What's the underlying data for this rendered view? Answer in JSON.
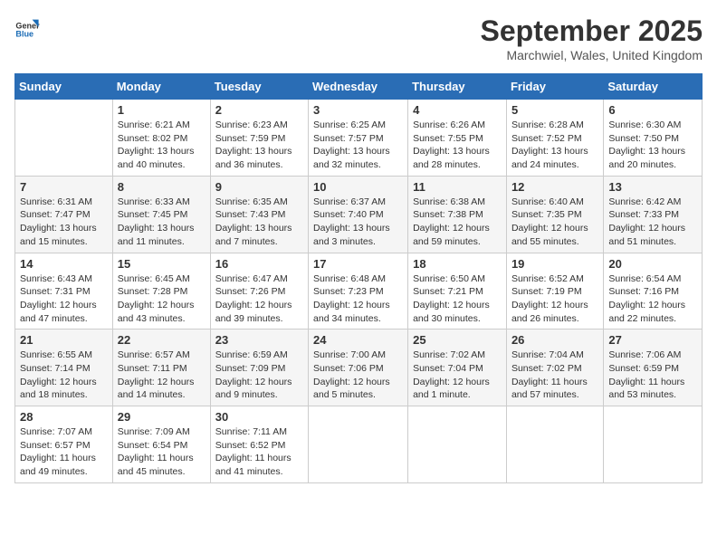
{
  "logo": {
    "general": "General",
    "blue": "Blue"
  },
  "title": "September 2025",
  "subtitle": "Marchwiel, Wales, United Kingdom",
  "days_header": [
    "Sunday",
    "Monday",
    "Tuesday",
    "Wednesday",
    "Thursday",
    "Friday",
    "Saturday"
  ],
  "weeks": [
    [
      {
        "day": "",
        "info": ""
      },
      {
        "day": "1",
        "info": "Sunrise: 6:21 AM\nSunset: 8:02 PM\nDaylight: 13 hours\nand 40 minutes."
      },
      {
        "day": "2",
        "info": "Sunrise: 6:23 AM\nSunset: 7:59 PM\nDaylight: 13 hours\nand 36 minutes."
      },
      {
        "day": "3",
        "info": "Sunrise: 6:25 AM\nSunset: 7:57 PM\nDaylight: 13 hours\nand 32 minutes."
      },
      {
        "day": "4",
        "info": "Sunrise: 6:26 AM\nSunset: 7:55 PM\nDaylight: 13 hours\nand 28 minutes."
      },
      {
        "day": "5",
        "info": "Sunrise: 6:28 AM\nSunset: 7:52 PM\nDaylight: 13 hours\nand 24 minutes."
      },
      {
        "day": "6",
        "info": "Sunrise: 6:30 AM\nSunset: 7:50 PM\nDaylight: 13 hours\nand 20 minutes."
      }
    ],
    [
      {
        "day": "7",
        "info": "Sunrise: 6:31 AM\nSunset: 7:47 PM\nDaylight: 13 hours\nand 15 minutes."
      },
      {
        "day": "8",
        "info": "Sunrise: 6:33 AM\nSunset: 7:45 PM\nDaylight: 13 hours\nand 11 minutes."
      },
      {
        "day": "9",
        "info": "Sunrise: 6:35 AM\nSunset: 7:43 PM\nDaylight: 13 hours\nand 7 minutes."
      },
      {
        "day": "10",
        "info": "Sunrise: 6:37 AM\nSunset: 7:40 PM\nDaylight: 13 hours\nand 3 minutes."
      },
      {
        "day": "11",
        "info": "Sunrise: 6:38 AM\nSunset: 7:38 PM\nDaylight: 12 hours\nand 59 minutes."
      },
      {
        "day": "12",
        "info": "Sunrise: 6:40 AM\nSunset: 7:35 PM\nDaylight: 12 hours\nand 55 minutes."
      },
      {
        "day": "13",
        "info": "Sunrise: 6:42 AM\nSunset: 7:33 PM\nDaylight: 12 hours\nand 51 minutes."
      }
    ],
    [
      {
        "day": "14",
        "info": "Sunrise: 6:43 AM\nSunset: 7:31 PM\nDaylight: 12 hours\nand 47 minutes."
      },
      {
        "day": "15",
        "info": "Sunrise: 6:45 AM\nSunset: 7:28 PM\nDaylight: 12 hours\nand 43 minutes."
      },
      {
        "day": "16",
        "info": "Sunrise: 6:47 AM\nSunset: 7:26 PM\nDaylight: 12 hours\nand 39 minutes."
      },
      {
        "day": "17",
        "info": "Sunrise: 6:48 AM\nSunset: 7:23 PM\nDaylight: 12 hours\nand 34 minutes."
      },
      {
        "day": "18",
        "info": "Sunrise: 6:50 AM\nSunset: 7:21 PM\nDaylight: 12 hours\nand 30 minutes."
      },
      {
        "day": "19",
        "info": "Sunrise: 6:52 AM\nSunset: 7:19 PM\nDaylight: 12 hours\nand 26 minutes."
      },
      {
        "day": "20",
        "info": "Sunrise: 6:54 AM\nSunset: 7:16 PM\nDaylight: 12 hours\nand 22 minutes."
      }
    ],
    [
      {
        "day": "21",
        "info": "Sunrise: 6:55 AM\nSunset: 7:14 PM\nDaylight: 12 hours\nand 18 minutes."
      },
      {
        "day": "22",
        "info": "Sunrise: 6:57 AM\nSunset: 7:11 PM\nDaylight: 12 hours\nand 14 minutes."
      },
      {
        "day": "23",
        "info": "Sunrise: 6:59 AM\nSunset: 7:09 PM\nDaylight: 12 hours\nand 9 minutes."
      },
      {
        "day": "24",
        "info": "Sunrise: 7:00 AM\nSunset: 7:06 PM\nDaylight: 12 hours\nand 5 minutes."
      },
      {
        "day": "25",
        "info": "Sunrise: 7:02 AM\nSunset: 7:04 PM\nDaylight: 12 hours\nand 1 minute."
      },
      {
        "day": "26",
        "info": "Sunrise: 7:04 AM\nSunset: 7:02 PM\nDaylight: 11 hours\nand 57 minutes."
      },
      {
        "day": "27",
        "info": "Sunrise: 7:06 AM\nSunset: 6:59 PM\nDaylight: 11 hours\nand 53 minutes."
      }
    ],
    [
      {
        "day": "28",
        "info": "Sunrise: 7:07 AM\nSunset: 6:57 PM\nDaylight: 11 hours\nand 49 minutes."
      },
      {
        "day": "29",
        "info": "Sunrise: 7:09 AM\nSunset: 6:54 PM\nDaylight: 11 hours\nand 45 minutes."
      },
      {
        "day": "30",
        "info": "Sunrise: 7:11 AM\nSunset: 6:52 PM\nDaylight: 11 hours\nand 41 minutes."
      },
      {
        "day": "",
        "info": ""
      },
      {
        "day": "",
        "info": ""
      },
      {
        "day": "",
        "info": ""
      },
      {
        "day": "",
        "info": ""
      }
    ]
  ]
}
